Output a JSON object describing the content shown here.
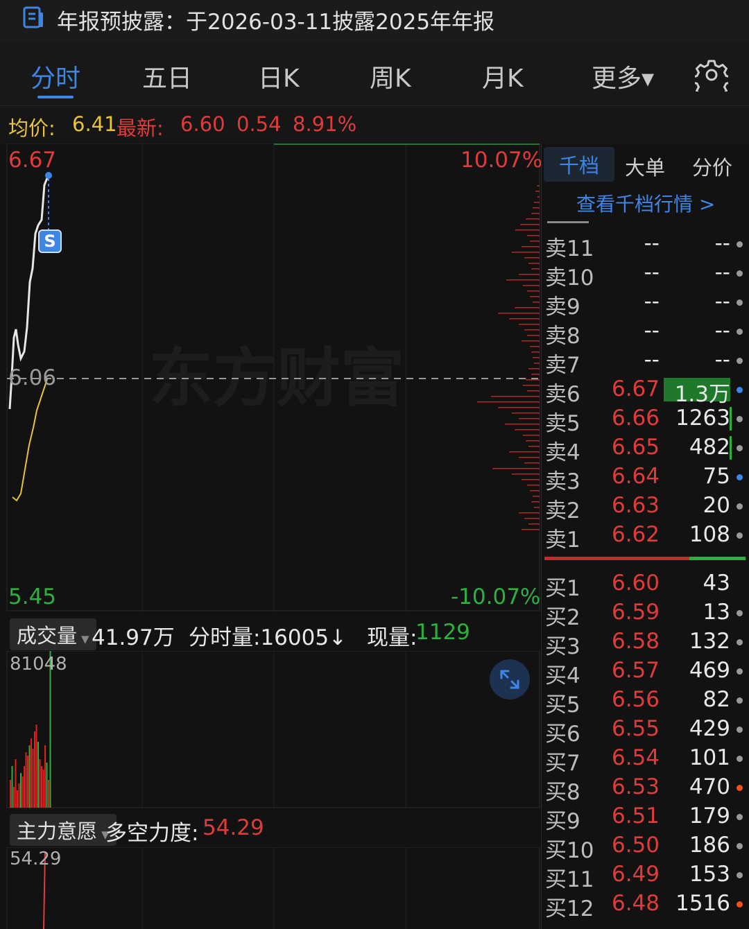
{
  "header": {
    "title": "年报预披露：于2026-03-11披露2025年年报",
    "icon": "report-icon"
  },
  "tabs": [
    {
      "label": "分时",
      "active": true
    },
    {
      "label": "五日"
    },
    {
      "label": "日K"
    },
    {
      "label": "周K"
    },
    {
      "label": "月K"
    },
    {
      "label": "更多▾"
    }
  ],
  "info": {
    "avg_label": "均价:",
    "avg_value": "6.41",
    "latest_label": "最新:",
    "latest_value": "6.60",
    "change": "0.54",
    "change_pct": "8.91%"
  },
  "price_chart": {
    "high": "6.67",
    "high_pct": "10.07%",
    "mid": "6.06",
    "low": "5.45",
    "low_pct": "-10.07%",
    "marker": "S",
    "watermark": "东方财富",
    "colors": {
      "price_line": "#e6e6e6",
      "avg_line": "#e8c33a",
      "up": "#e03b3b",
      "down": "#2db040"
    }
  },
  "volume_panel": {
    "selector": "成交量",
    "total": "41.97万",
    "segment_label": "分时量:16005↓",
    "now_label": "现量:",
    "now_value": "1129",
    "max_label": "81048"
  },
  "force_panel": {
    "selector": "主力意愿",
    "label": "多空力度:",
    "value": "54.29",
    "axis_value": "54.29"
  },
  "order_book": {
    "tabs": [
      {
        "label": "千档",
        "active": true
      },
      {
        "label": "大单"
      },
      {
        "label": "分价"
      }
    ],
    "link": "查看千档行情 >",
    "asks": [
      {
        "label": "卖11",
        "price": "--",
        "volume": "--",
        "dot": "gray"
      },
      {
        "label": "卖10",
        "price": "--",
        "volume": "--",
        "dot": "gray"
      },
      {
        "label": "卖9",
        "price": "--",
        "volume": "--",
        "dot": "gray"
      },
      {
        "label": "卖8",
        "price": "--",
        "volume": "--",
        "dot": "gray"
      },
      {
        "label": "卖7",
        "price": "--",
        "volume": "--",
        "dot": "gray"
      },
      {
        "label": "卖6",
        "price": "6.67",
        "volume": "1.3万",
        "dot": "blue",
        "fill": 0.32
      },
      {
        "label": "卖5",
        "price": "6.66",
        "volume": "1263",
        "dot": "gray",
        "bar": true
      },
      {
        "label": "卖4",
        "price": "6.65",
        "volume": "482",
        "dot": "gray",
        "bar": true
      },
      {
        "label": "卖3",
        "price": "6.64",
        "volume": "75",
        "dot": "blue"
      },
      {
        "label": "卖2",
        "price": "6.63",
        "volume": "20",
        "dot": "gray"
      },
      {
        "label": "卖1",
        "price": "6.62",
        "volume": "108",
        "dot": "gray"
      }
    ],
    "bids": [
      {
        "label": "买1",
        "price": "6.60",
        "volume": "43",
        "dot": "none"
      },
      {
        "label": "买2",
        "price": "6.59",
        "volume": "13",
        "dot": "gray"
      },
      {
        "label": "买3",
        "price": "6.58",
        "volume": "132",
        "dot": "gray"
      },
      {
        "label": "买4",
        "price": "6.57",
        "volume": "469",
        "dot": "gray"
      },
      {
        "label": "买5",
        "price": "6.56",
        "volume": "82",
        "dot": "gray"
      },
      {
        "label": "买6",
        "price": "6.55",
        "volume": "429",
        "dot": "gray"
      },
      {
        "label": "买7",
        "price": "6.54",
        "volume": "101",
        "dot": "gray"
      },
      {
        "label": "买8",
        "price": "6.53",
        "volume": "470",
        "dot": "orange"
      },
      {
        "label": "买9",
        "price": "6.51",
        "volume": "179",
        "dot": "gray"
      },
      {
        "label": "买10",
        "price": "6.50",
        "volume": "186",
        "dot": "gray"
      },
      {
        "label": "买11",
        "price": "6.49",
        "volume": "153",
        "dot": "gray"
      },
      {
        "label": "买12",
        "price": "6.48",
        "volume": "1516",
        "dot": "orange"
      }
    ],
    "split_ratio": 0.72
  }
}
